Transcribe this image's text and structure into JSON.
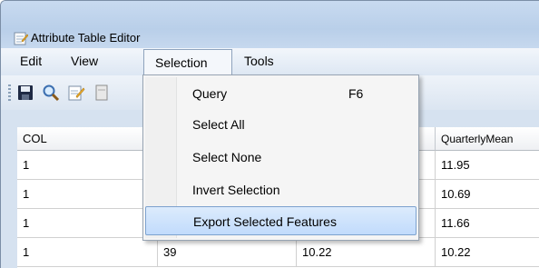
{
  "window": {
    "title": "Attribute Table Editor"
  },
  "menubar": {
    "items": [
      "Edit",
      "View",
      "Selection",
      "Tools"
    ],
    "active": "Selection"
  },
  "toolbar": {
    "icons": [
      "save-icon",
      "search-icon",
      "edit-icon",
      "document-icon"
    ]
  },
  "table": {
    "columns": [
      "COL",
      "",
      "",
      "QuarterlyMean"
    ],
    "rows": [
      [
        "1",
        "",
        "",
        "11.95"
      ],
      [
        "1",
        "",
        "",
        "10.69"
      ],
      [
        "1",
        "",
        "",
        "11.66"
      ],
      [
        "1",
        "39",
        "10.22",
        "10.22"
      ]
    ]
  },
  "selection_menu": {
    "items": [
      {
        "label": "Query",
        "shortcut": "F6"
      },
      {
        "label": "Select All",
        "shortcut": ""
      },
      {
        "label": "Select None",
        "shortcut": ""
      },
      {
        "label": "Invert Selection",
        "shortcut": ""
      },
      {
        "label": "Export Selected Features",
        "shortcut": "",
        "highlighted": true
      }
    ]
  }
}
